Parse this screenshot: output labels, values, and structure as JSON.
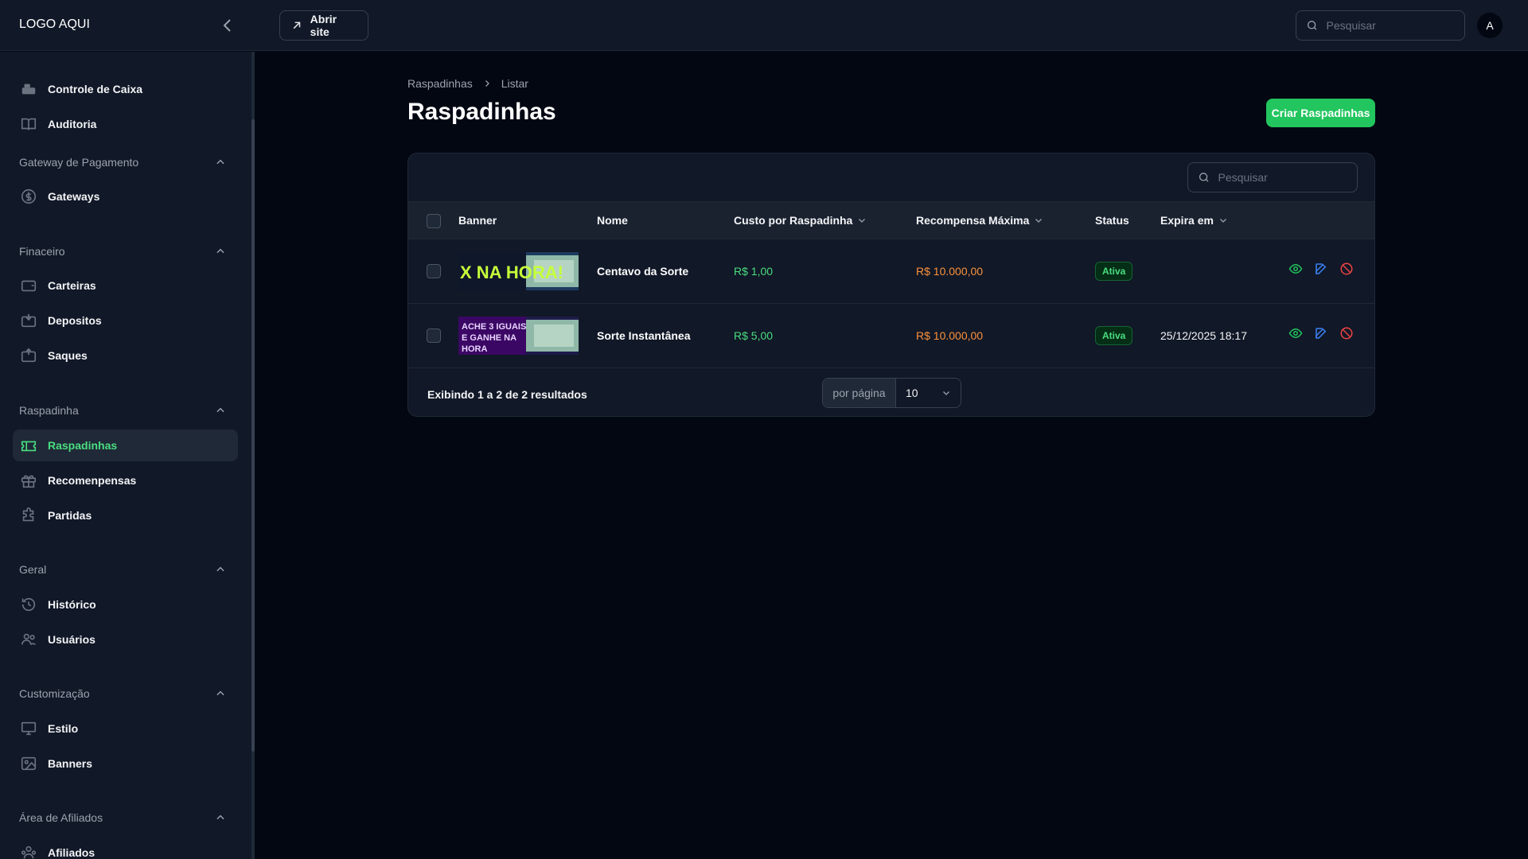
{
  "topbar": {
    "logo": "LOGO AQUI",
    "open_site": "Abrir site",
    "search_placeholder": "Pesquisar",
    "avatar_initial": "A"
  },
  "sidebar": {
    "items_top": [
      {
        "label": "Controle de Caixa",
        "icon": "cash-register-icon"
      },
      {
        "label": "Auditoria",
        "icon": "book-open-icon"
      }
    ],
    "groups": [
      {
        "label": "Gateway de Pagamento",
        "items": [
          {
            "label": "Gateways",
            "icon": "dollar-circle-icon"
          }
        ]
      },
      {
        "label": "Finaceiro",
        "items": [
          {
            "label": "Carteiras",
            "icon": "wallet-icon"
          },
          {
            "label": "Depositos",
            "icon": "deposit-icon"
          },
          {
            "label": "Saques",
            "icon": "withdraw-icon"
          }
        ]
      },
      {
        "label": "Raspadinha",
        "items": [
          {
            "label": "Raspadinhas",
            "icon": "ticket-icon",
            "active": true
          },
          {
            "label": "Recomenpensas",
            "icon": "gift-icon"
          },
          {
            "label": "Partidas",
            "icon": "puzzle-icon"
          }
        ]
      },
      {
        "label": "Geral",
        "items": [
          {
            "label": "Histórico",
            "icon": "history-icon"
          },
          {
            "label": "Usuários",
            "icon": "users-icon"
          }
        ]
      },
      {
        "label": "Customização",
        "items": [
          {
            "label": "Estilo",
            "icon": "computer-icon"
          },
          {
            "label": "Banners",
            "icon": "image-icon"
          }
        ]
      },
      {
        "label": "Área de Afiliados",
        "items": [
          {
            "label": "Afiliados",
            "icon": "affiliates-icon"
          }
        ]
      }
    ]
  },
  "breadcrumb": {
    "parent": "Raspadinhas",
    "current": "Listar"
  },
  "page": {
    "title": "Raspadinhas",
    "create_button": "Criar Raspadinhas"
  },
  "table": {
    "search_placeholder": "Pesquisar",
    "columns": {
      "banner": "Banner",
      "name": "Nome",
      "cost": "Custo por Raspadinha",
      "reward": "Recompensa Máxima",
      "status": "Status",
      "expires": "Expira em"
    },
    "rows": [
      {
        "banner_text": "X NA HORA!",
        "name": "Centavo da Sorte",
        "cost": "R$ 1,00",
        "reward": "R$ 10.000,00",
        "status": "Ativa",
        "expires": ""
      },
      {
        "banner_text": "ACHE 3 IGUAIS E GANHE NA HORA",
        "name": "Sorte Instantânea",
        "cost": "R$ 5,00",
        "reward": "R$ 10.000,00",
        "status": "Ativa",
        "expires": "25/12/2025 18:17"
      }
    ],
    "footer": {
      "summary": "Exibindo 1 a 2 de 2 resultados",
      "per_page_label": "por página",
      "per_page_value": "10"
    }
  },
  "colors": {
    "accent": "#22c55e",
    "background": "#030712",
    "panel": "#111827",
    "reward": "#fb923c"
  }
}
